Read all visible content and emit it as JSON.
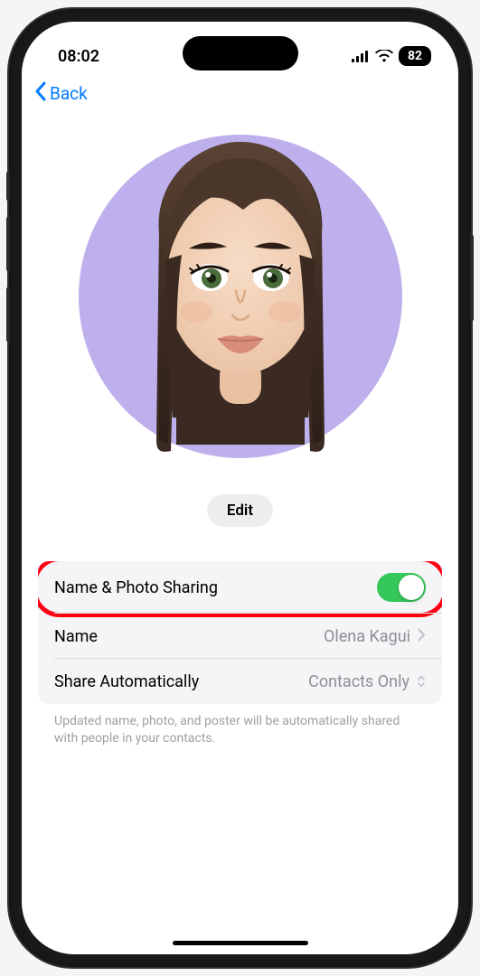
{
  "status": {
    "time": "08:02",
    "battery": "82"
  },
  "nav": {
    "back_label": "Back"
  },
  "avatar": {
    "bg_color": "#beb0ec",
    "edit_label": "Edit"
  },
  "settings": {
    "rows": [
      {
        "label": "Name & Photo Sharing",
        "type": "toggle",
        "value": true,
        "highlighted": true
      },
      {
        "label": "Name",
        "type": "nav",
        "value": "Olena Kagui"
      },
      {
        "label": "Share Automatically",
        "type": "select",
        "value": "Contacts Only"
      }
    ],
    "footer": "Updated name, photo, and poster will be automatically shared with people in your contacts."
  }
}
